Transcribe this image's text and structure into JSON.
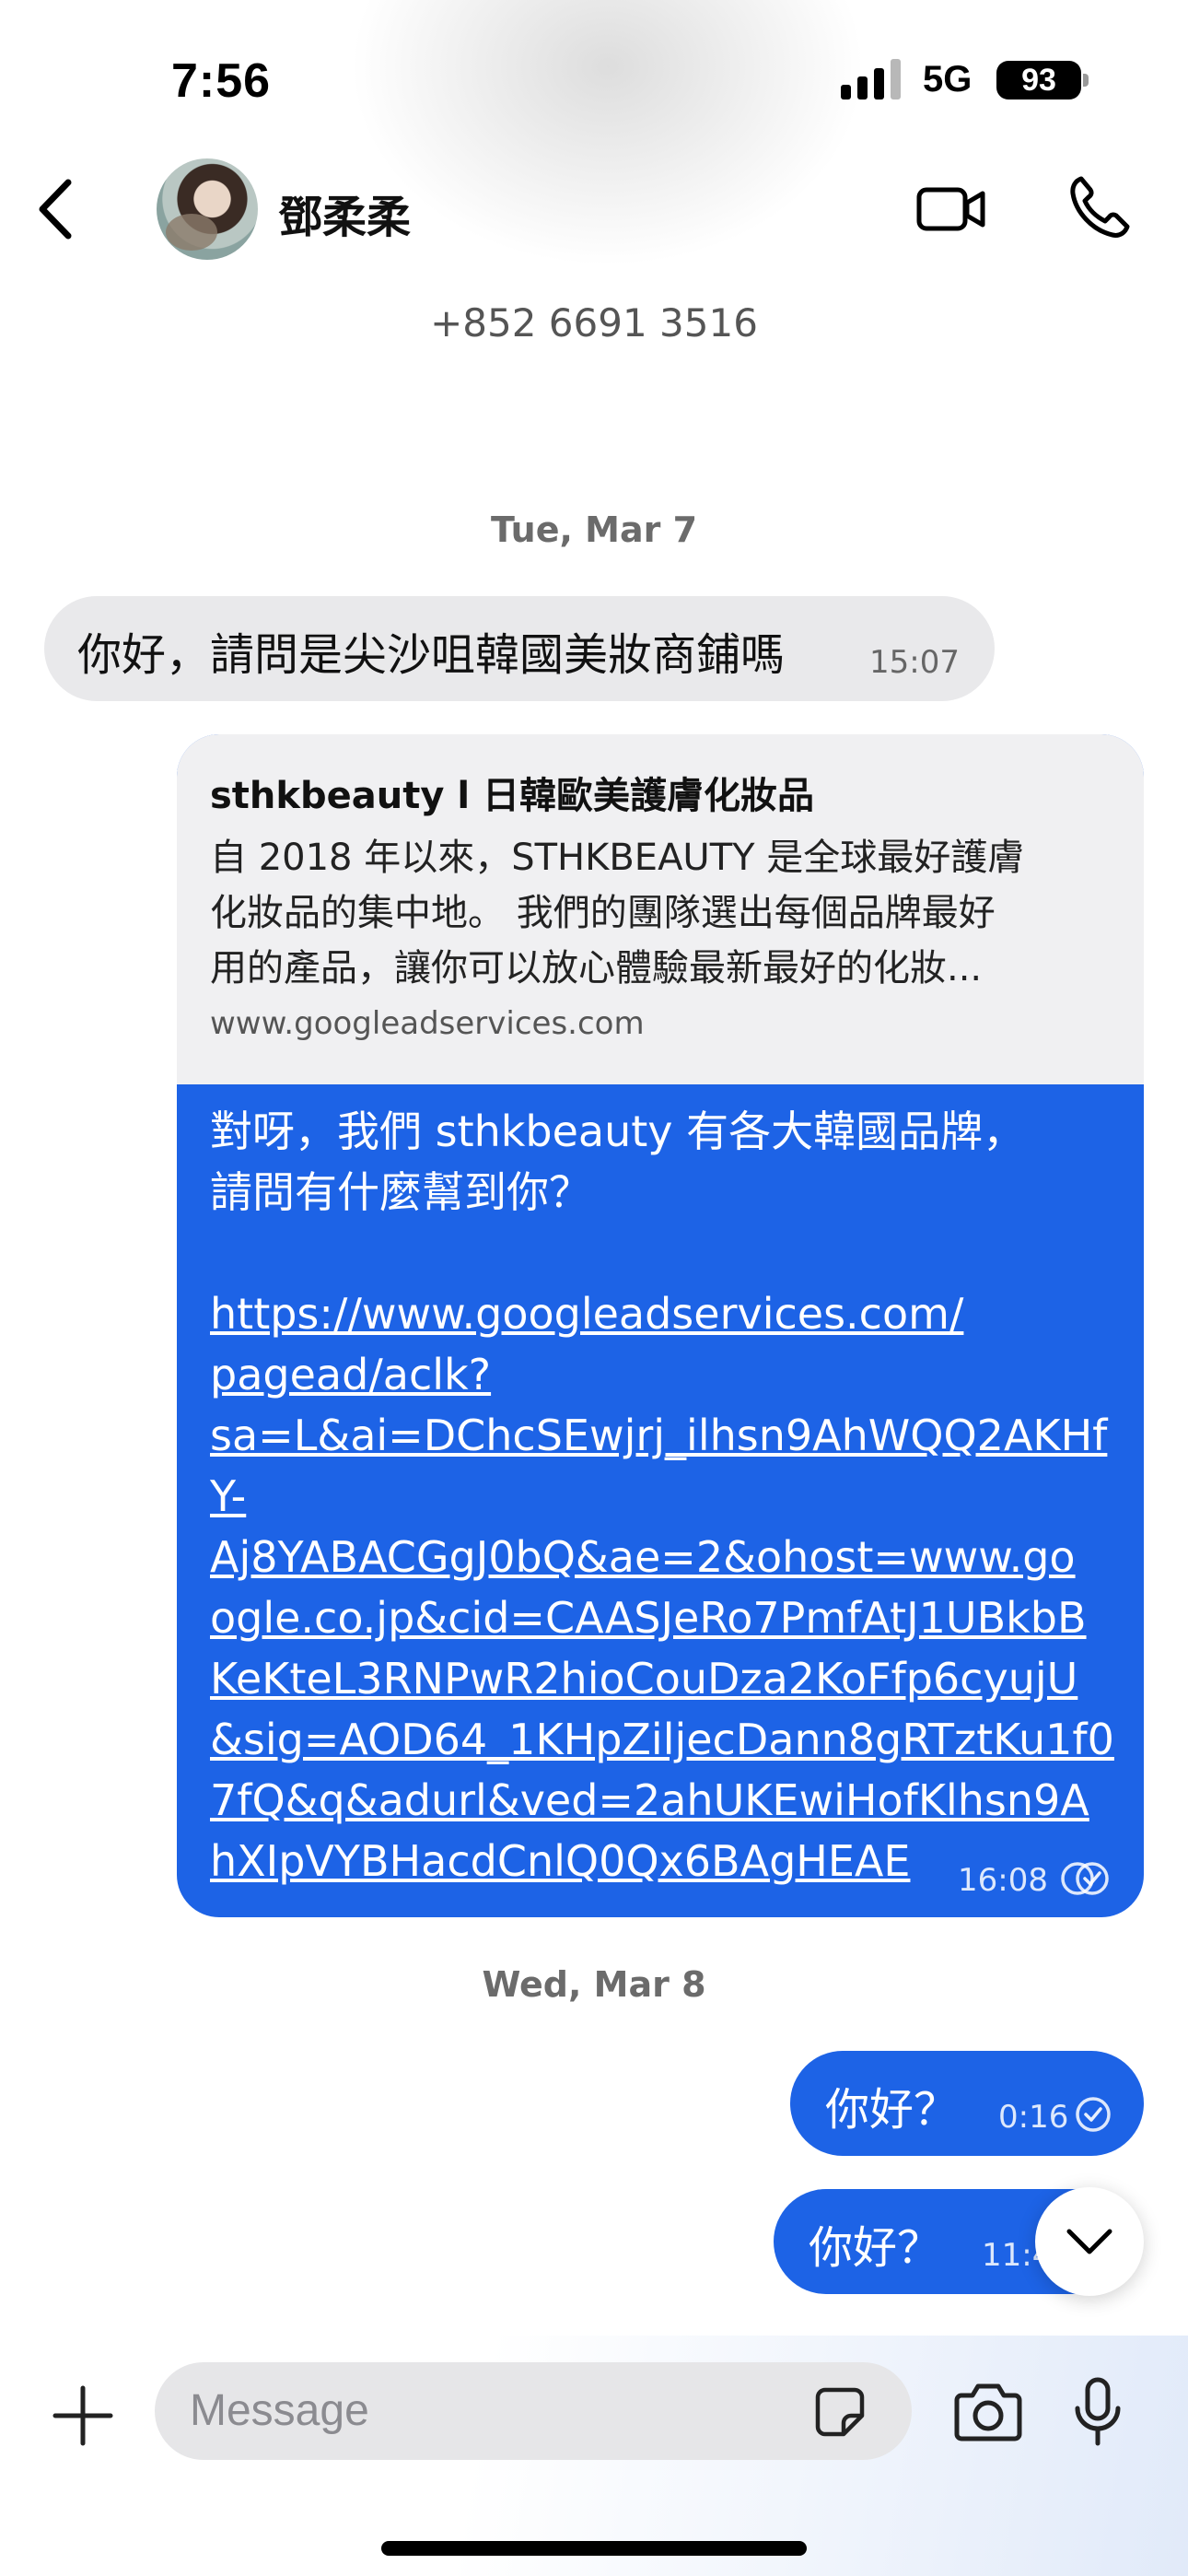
{
  "status_bar": {
    "time": "7:56",
    "network": "5G",
    "battery": "93"
  },
  "header": {
    "contact_name": "鄧柔柔",
    "phone_number": "+852 6691 3516"
  },
  "dates": {
    "first": "Tue, Mar 7",
    "second": "Wed, Mar 8"
  },
  "messages": {
    "incoming_1": {
      "text": "你好，請問是尖沙咀韓國美妝商鋪嗎",
      "time": "15:07"
    },
    "link_card": {
      "preview_title": "sthkbeauty l 日韓歐美護膚化妝品",
      "preview_desc_lines": [
        "自 2018 年以來，STHKBEAUTY 是全球最好護膚",
        "化妝品的集中地。 我們的團隊選出每個品牌最好",
        "用的產品，讓你可以放心體驗最新最好的化妝..."
      ],
      "preview_domain": "www.googleadservices.com",
      "body_lines": [
        "對呀，我們 sthkbeauty 有各大韓國品牌，",
        "請問有什麼幫到你？"
      ],
      "link_lines": [
        "https://www.googleadservices.com/",
        "pagead/aclk?",
        "sa=L&ai=DChcSEwjrj_ilhsn9AhWQQ2AKHf",
        "Y-",
        "Aj8YABACGgJ0bQ&ae=2&ohost=www.go",
        "ogle.co.jp&cid=CAASJeRo7PmfAtJ1UBkbB",
        "KeKteL3RNPwR2hioCouDza2KoFfp6cyujU",
        "&sig=AOD64_1KHpZiljecDann8gRTztKu1f0",
        "7fQ&q&adurl&ved=2ahUKEwiHofKlhsn9A",
        "hXIpVYBHacdCnlQ0Qx6BAgHEAE"
      ],
      "time": "16:08"
    },
    "outgoing_1": {
      "text": "你好？",
      "time": "0:16"
    },
    "outgoing_2": {
      "text": "你好？",
      "time": "11:4"
    }
  },
  "composer": {
    "placeholder": "Message"
  },
  "colors": {
    "bubble_out": "#1d63e6",
    "bubble_in": "#e9e9eb"
  }
}
